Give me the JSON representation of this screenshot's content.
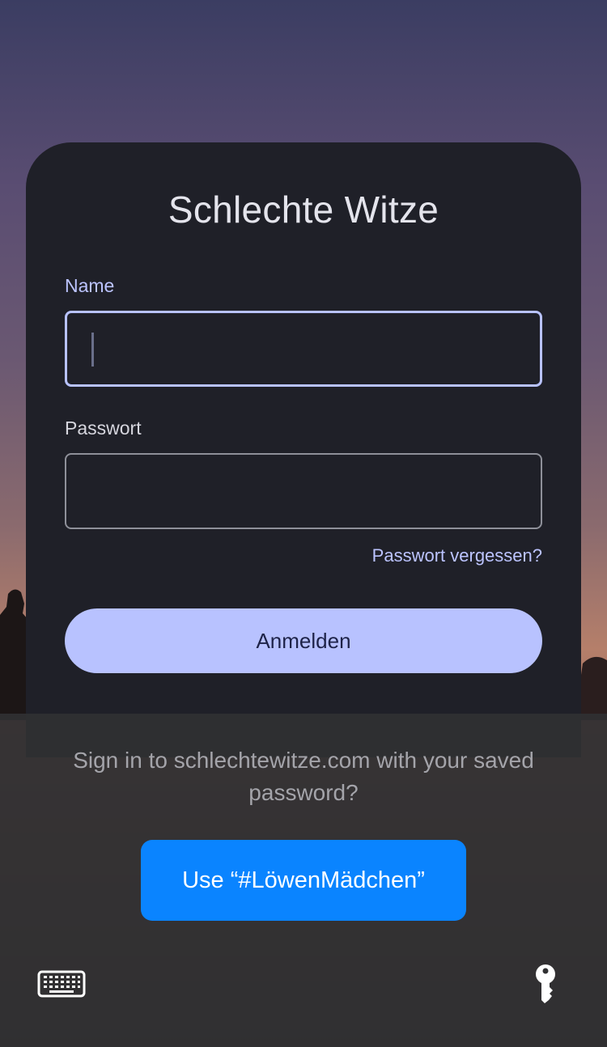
{
  "form": {
    "title": "Schlechte Witze",
    "name_label": "Name",
    "name_value": "",
    "password_label": "Passwort",
    "password_value": "",
    "forgot_link": "Passwort vergessen?",
    "login_button": "Anmelden"
  },
  "password_sheet": {
    "prompt": "Sign in to schlechtewitze.com with your saved password?",
    "use_button": "Use “#LöwenMädchen”",
    "keyboard_icon": "keyboard-icon",
    "key_icon": "key-icon"
  },
  "colors": {
    "card_background": "#1f2028",
    "accent": "#b8c2ff",
    "login_button_text": "#1e2348",
    "use_button": "#0a84ff",
    "sheet_background": "#303032"
  }
}
